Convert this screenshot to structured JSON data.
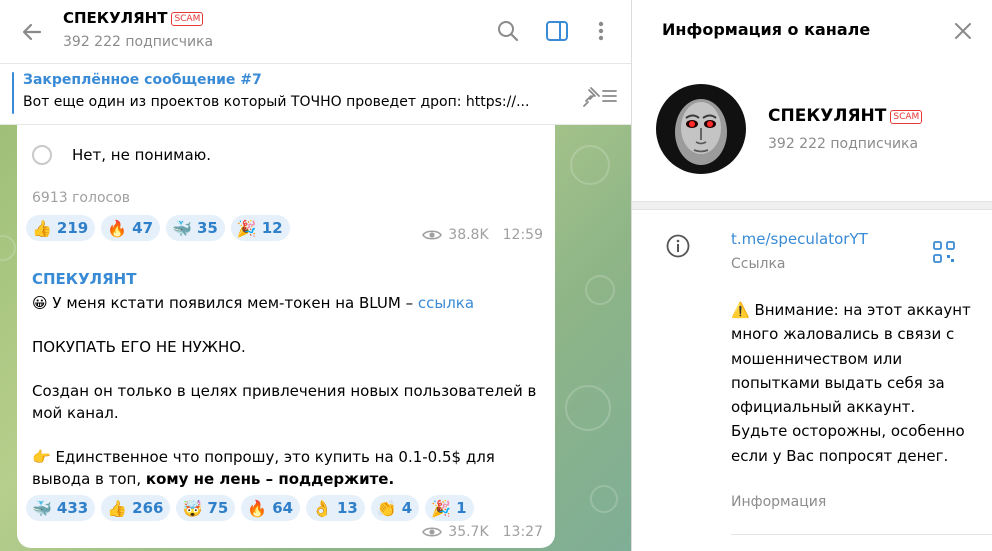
{
  "header": {
    "channel_name": "СПЕКУЛЯНТ",
    "scam_badge": "SCAM",
    "subscribers": "392 222 подписчика"
  },
  "pinned": {
    "title": "Закреплённое сообщение #7",
    "text": "Вот еще один из проектов который ТОЧНО проведет дроп:  https://..."
  },
  "message1": {
    "poll_option": "Нет, не понимаю.",
    "votes": "6913 голосов",
    "reactions": [
      {
        "emoji": "👍",
        "count": "219"
      },
      {
        "emoji": "🔥",
        "count": "47"
      },
      {
        "emoji": "🐳",
        "count": "35"
      },
      {
        "emoji": "🎉",
        "count": "12"
      }
    ],
    "views": "38.8K",
    "time": "12:59"
  },
  "message2": {
    "author": "СПЕКУЛЯНТ",
    "line1_emoji": "😀",
    "line1_text": " У меня кстати появился мем-токен на BLUM – ",
    "line1_link": "ссылка",
    "line2": "ПОКУПАТЬ ЕГО НЕ НУЖНО.",
    "line3": "Создан он только в целях привлечения новых пользователей в",
    "line4": "мой канал.",
    "line5_emoji": "👉",
    "line5_text": " Единственное что попрошу, это купить на 0.1-0.5$ для",
    "line6_text": "вывода в топ, ",
    "line6_bold": "кому не лень – поддержите.",
    "reactions": [
      {
        "emoji": "🐳",
        "count": "433"
      },
      {
        "emoji": "👍",
        "count": "266"
      },
      {
        "emoji": "🤯",
        "count": "75"
      },
      {
        "emoji": "🔥",
        "count": "64"
      },
      {
        "emoji": "👌",
        "count": "13"
      },
      {
        "emoji": "👏",
        "count": "4"
      },
      {
        "emoji": "🎉",
        "count": "1"
      }
    ],
    "views": "35.7K",
    "time": "13:27"
  },
  "info_panel": {
    "title": "Информация о канале",
    "channel_name": "СПЕКУЛЯНТ",
    "scam_badge": "SCAM",
    "subscribers": "392 222 подписчика",
    "link": "t.me/speculatorYT",
    "link_caption": "Ссылка",
    "warning": "⚠️ Внимание: на этот аккаунт много жаловались в связи с мошенничеством или попытками выдать себя за официальный аккаунт. Будьте осторожны, особенно если у Вас попросят денег.",
    "warning_caption": "Информация"
  },
  "colors": {
    "accent": "#3a8bd6",
    "scam": "#e53935",
    "muted": "#8c8c8c"
  },
  "icons": [
    "back-arrow-icon",
    "search-icon",
    "sidebar-toggle-icon",
    "more-vertical-icon",
    "unpin-list-icon",
    "close-icon",
    "info-icon",
    "qr-code-icon",
    "eye-icon"
  ]
}
